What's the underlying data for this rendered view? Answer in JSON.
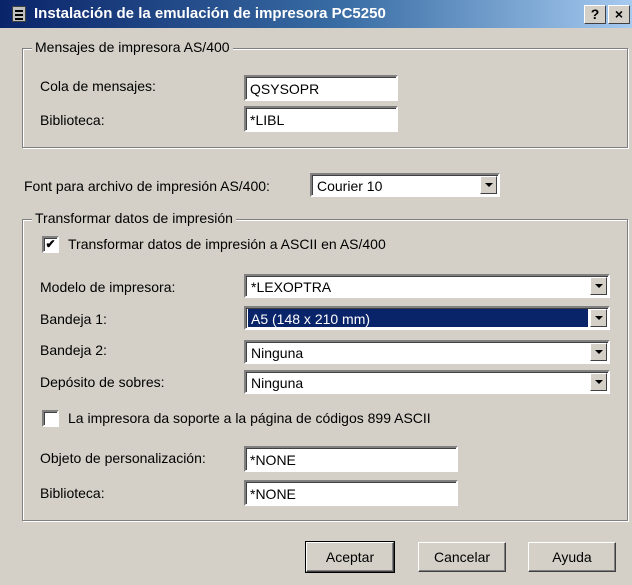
{
  "window": {
    "title": "Instalación de la emulación de impresora PC5250",
    "help_btn": "?",
    "close_btn": "×"
  },
  "messages_group": {
    "legend": "Mensajes de impresora AS/400",
    "queue_label": "Cola de mensajes:",
    "queue_value": "QSYSOPR",
    "library_label": "Biblioteca:",
    "library_value": "*LIBL"
  },
  "font": {
    "label": "Font para archivo de impresión AS/400:",
    "value": "Courier 10"
  },
  "transform_group": {
    "legend": "Transformar datos de impresión",
    "transform_checkbox_label": "Transformar datos de impresión a ASCII en AS/400",
    "transform_checked": true,
    "printer_model_label": "Modelo de impresora:",
    "printer_model_value": "*LEXOPTRA",
    "tray1_label": "Bandeja 1:",
    "tray1_value": "A5 (148 x 210 mm)",
    "tray2_label": "Bandeja 2:",
    "tray2_value": "Ninguna",
    "envelope_label": "Depósito de sobres:",
    "envelope_value": "Ninguna",
    "codepage_checkbox_label": "La impresora da soporte a la página de códigos 899 ASCII",
    "codepage_checked": false,
    "custom_object_label": "Objeto de personalización:",
    "custom_object_value": "*NONE",
    "custom_library_label": "Biblioteca:",
    "custom_library_value": "*NONE"
  },
  "buttons": {
    "ok": "Aceptar",
    "cancel": "Cancelar",
    "help": "Ayuda"
  }
}
